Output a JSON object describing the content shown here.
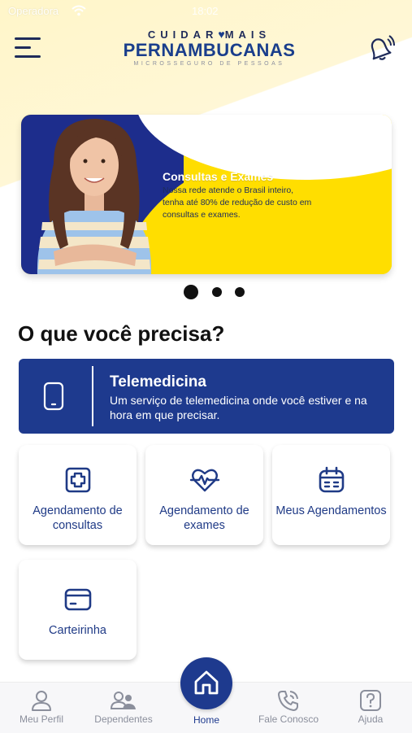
{
  "status_bar": {
    "carrier": "Operadora",
    "time": "18:02"
  },
  "header": {
    "logo_top_left": "CUIDAR",
    "logo_top_right": "MAIS",
    "logo_main": "PERNAMBUCANAS",
    "logo_sub": "MICROSSEGURO DE PESSOAS"
  },
  "banner": {
    "title": "Consultas e Exames",
    "text": "Nossa rede atende o Brasil inteiro, tenha até 80% de redução de custo em consultas e exames.",
    "active_slide": 1,
    "slide_count": 3
  },
  "section_title": "O que você precisa?",
  "telemedicina": {
    "title": "Telemedicina",
    "description": "Um serviço de telemedicina onde você estiver e na hora em que precisar."
  },
  "services": [
    {
      "label": "Agendamento de consultas",
      "icon": "medical-cross-icon"
    },
    {
      "label": "Agendamento de exames",
      "icon": "heartbeat-icon"
    },
    {
      "label": "Meus Agendamentos",
      "icon": "calendar-icon"
    },
    {
      "label": "Carteirinha",
      "icon": "card-icon"
    }
  ],
  "bottom_nav": {
    "profile": "Meu Perfil",
    "dependents": "Dependentes",
    "home": "Home",
    "contact": "Fale Conosco",
    "help": "Ajuda"
  },
  "colors": {
    "brand_navy": "#1e3a8e",
    "banner_yellow": "#ffde00",
    "background_yellow": "#fff6c9"
  }
}
